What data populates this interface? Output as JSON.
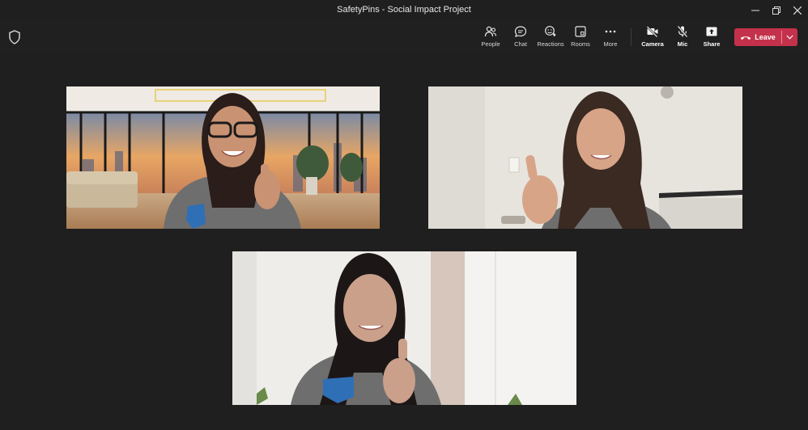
{
  "window": {
    "title": "SafetyPins - Social Impact Project",
    "controls": [
      "minimize-icon",
      "restore-icon",
      "close-icon"
    ]
  },
  "toolbar": {
    "security_icon": "shield-icon",
    "buttons": [
      {
        "label": "People",
        "icon": "people-icon"
      },
      {
        "label": "Chat",
        "icon": "chat-icon"
      },
      {
        "label": "Reactions",
        "icon": "reactions-icon"
      },
      {
        "label": "Rooms",
        "icon": "rooms-icon"
      },
      {
        "label": "More",
        "icon": "more-icon"
      },
      {
        "label": "Camera",
        "icon": "camera-off-icon"
      },
      {
        "label": "Mic",
        "icon": "mic-off-icon"
      },
      {
        "label": "Share",
        "icon": "share-icon"
      }
    ],
    "leave_label": "Leave",
    "leave_color": "#c4314b"
  },
  "participants": [
    {
      "background": "virtual-office-sunset"
    },
    {
      "background": "plain-wall"
    },
    {
      "background": "plain-wall"
    }
  ],
  "colors": {
    "background": "#1f1f1f",
    "toolbar": "#202020",
    "shirt": "#6e6e6e"
  }
}
